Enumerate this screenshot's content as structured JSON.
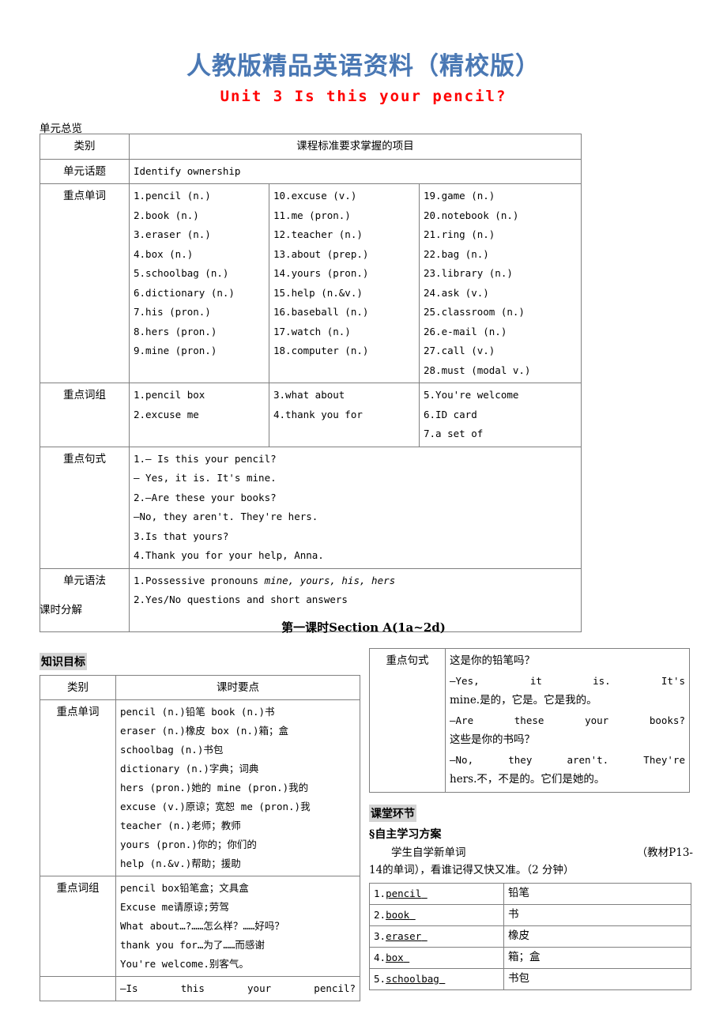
{
  "header": {
    "site_title": "人教版精品英语资料（精校版）",
    "unit_title": "Unit 3  Is this your pencil?",
    "title_color": "#4a78b4",
    "unit_color": "#ff0000"
  },
  "overview": {
    "label": "单元总览",
    "col_header_category": "类别",
    "col_header_items": "课程标准要求掌握的项目",
    "topic_label": "单元话题",
    "topic_value": "Identify ownership",
    "vocab_label": "重点单词",
    "vocab_col1": [
      "1.pencil (n.)",
      "2.book (n.)",
      "3.eraser (n.)",
      "4.box (n.)",
      "5.schoolbag (n.)",
      "6.dictionary (n.)",
      "7.his (pron.)",
      "8.hers (pron.)",
      "9.mine (pron.)"
    ],
    "vocab_col2": [
      "10.excuse (v.)",
      "11.me (pron.)",
      "12.teacher (n.)",
      "13.about (prep.)",
      "14.yours (pron.)",
      "15.help (n.&v.)",
      "16.baseball (n.)",
      "17.watch (n.)",
      "18.computer (n.)"
    ],
    "vocab_col3": [
      "19.game (n.)",
      "20.notebook (n.)",
      "21.ring (n.)",
      "22.bag (n.)",
      "23.library (n.)",
      "24.ask (v.)",
      "25.classroom (n.)",
      "26.e-mail (n.)",
      "27.call (v.)",
      "28.must (modal v.)"
    ],
    "phrase_label": "重点词组",
    "phrase_col1": [
      "1.pencil box",
      "2.excuse me"
    ],
    "phrase_col2": [
      "3.what about",
      "4.thank you for"
    ],
    "phrase_col3": [
      "5.You're welcome",
      "6.ID card",
      "7.a set of"
    ],
    "sentence_label": "重点句式",
    "sentences": [
      "1.— Is this your pencil?",
      " — Yes, it is. It's mine.",
      "2.—Are these your books? ",
      "—No, they aren't. They're hers.",
      "3.Is that yours?",
      "4.Thank you for your help, Anna."
    ],
    "grammar_label": "单元语法",
    "grammar_1_prefix": "1.Possessive pronouns ",
    "grammar_1_italic": "mine, yours, his, hers",
    "grammar_2": "2.Yes/No questions and short answers"
  },
  "breakdown": {
    "label": "课时分解",
    "section_title": "第一课时Section A(1a~2d)"
  },
  "knowledge": {
    "badge": "知识目标",
    "col_header_category": "类别",
    "col_header_points": "课时要点",
    "vocab_label": "重点单词",
    "vocab_lines": [
      "pencil (n.)铅笔  book (n.)书",
      "eraser (n.)橡皮  box (n.)箱；盒",
      "schoolbag (n.)书包",
      "dictionary (n.)字典；词典",
      "hers (pron.)她的  mine (pron.)我的",
      "excuse (v.)原谅；宽恕  me (pron.)我",
      "teacher (n.)老师；教师",
      "yours (pron.)你的；你们的",
      "help (n.&v.)帮助；援助"
    ],
    "phrase_label": "重点词组",
    "phrase_lines": [
      "pencil box铅笔盒；文具盒",
      "Excuse me请原谅;劳驾",
      "What about…?……怎么样？……好吗？",
      "thank you for…为了……而感谢",
      "You're welcome.别客气。"
    ],
    "last_row_text": "—Is this your pencil?"
  },
  "key_sentence": {
    "label": "重点句式",
    "line_cn_1": "这是你的铅笔吗？",
    "line_en_2": "—Yes, it is. It's",
    "line_mix_3": "mine.是的，它是。它是我的。",
    "line_en_4": "—Are these your books?",
    "line_cn_5": "这些是你的书吗？",
    "line_en_6": "—No, they aren't. They're",
    "line_mix_7": "hers.不，不是的。它们是她的。"
  },
  "classroom": {
    "badge": "课堂环节",
    "section_symbol": "§自主学习方案",
    "instruction_left": "学生自学新单词",
    "instruction_right": "（教材P13-",
    "instruction_line2": "14的单词），看谁记得又快又准。（2 分钟）"
  },
  "wordlist": {
    "rows": [
      {
        "num": "1.",
        "word": "pencil",
        "meaning": "铅笔"
      },
      {
        "num": "2.",
        "word": "book",
        "meaning": "书"
      },
      {
        "num": "3.",
        "word": "eraser",
        "meaning": "橡皮"
      },
      {
        "num": "4.",
        "word": "box",
        "meaning": "箱；盒"
      },
      {
        "num": "5.",
        "word": "schoolbag",
        "meaning": "书包"
      }
    ]
  }
}
